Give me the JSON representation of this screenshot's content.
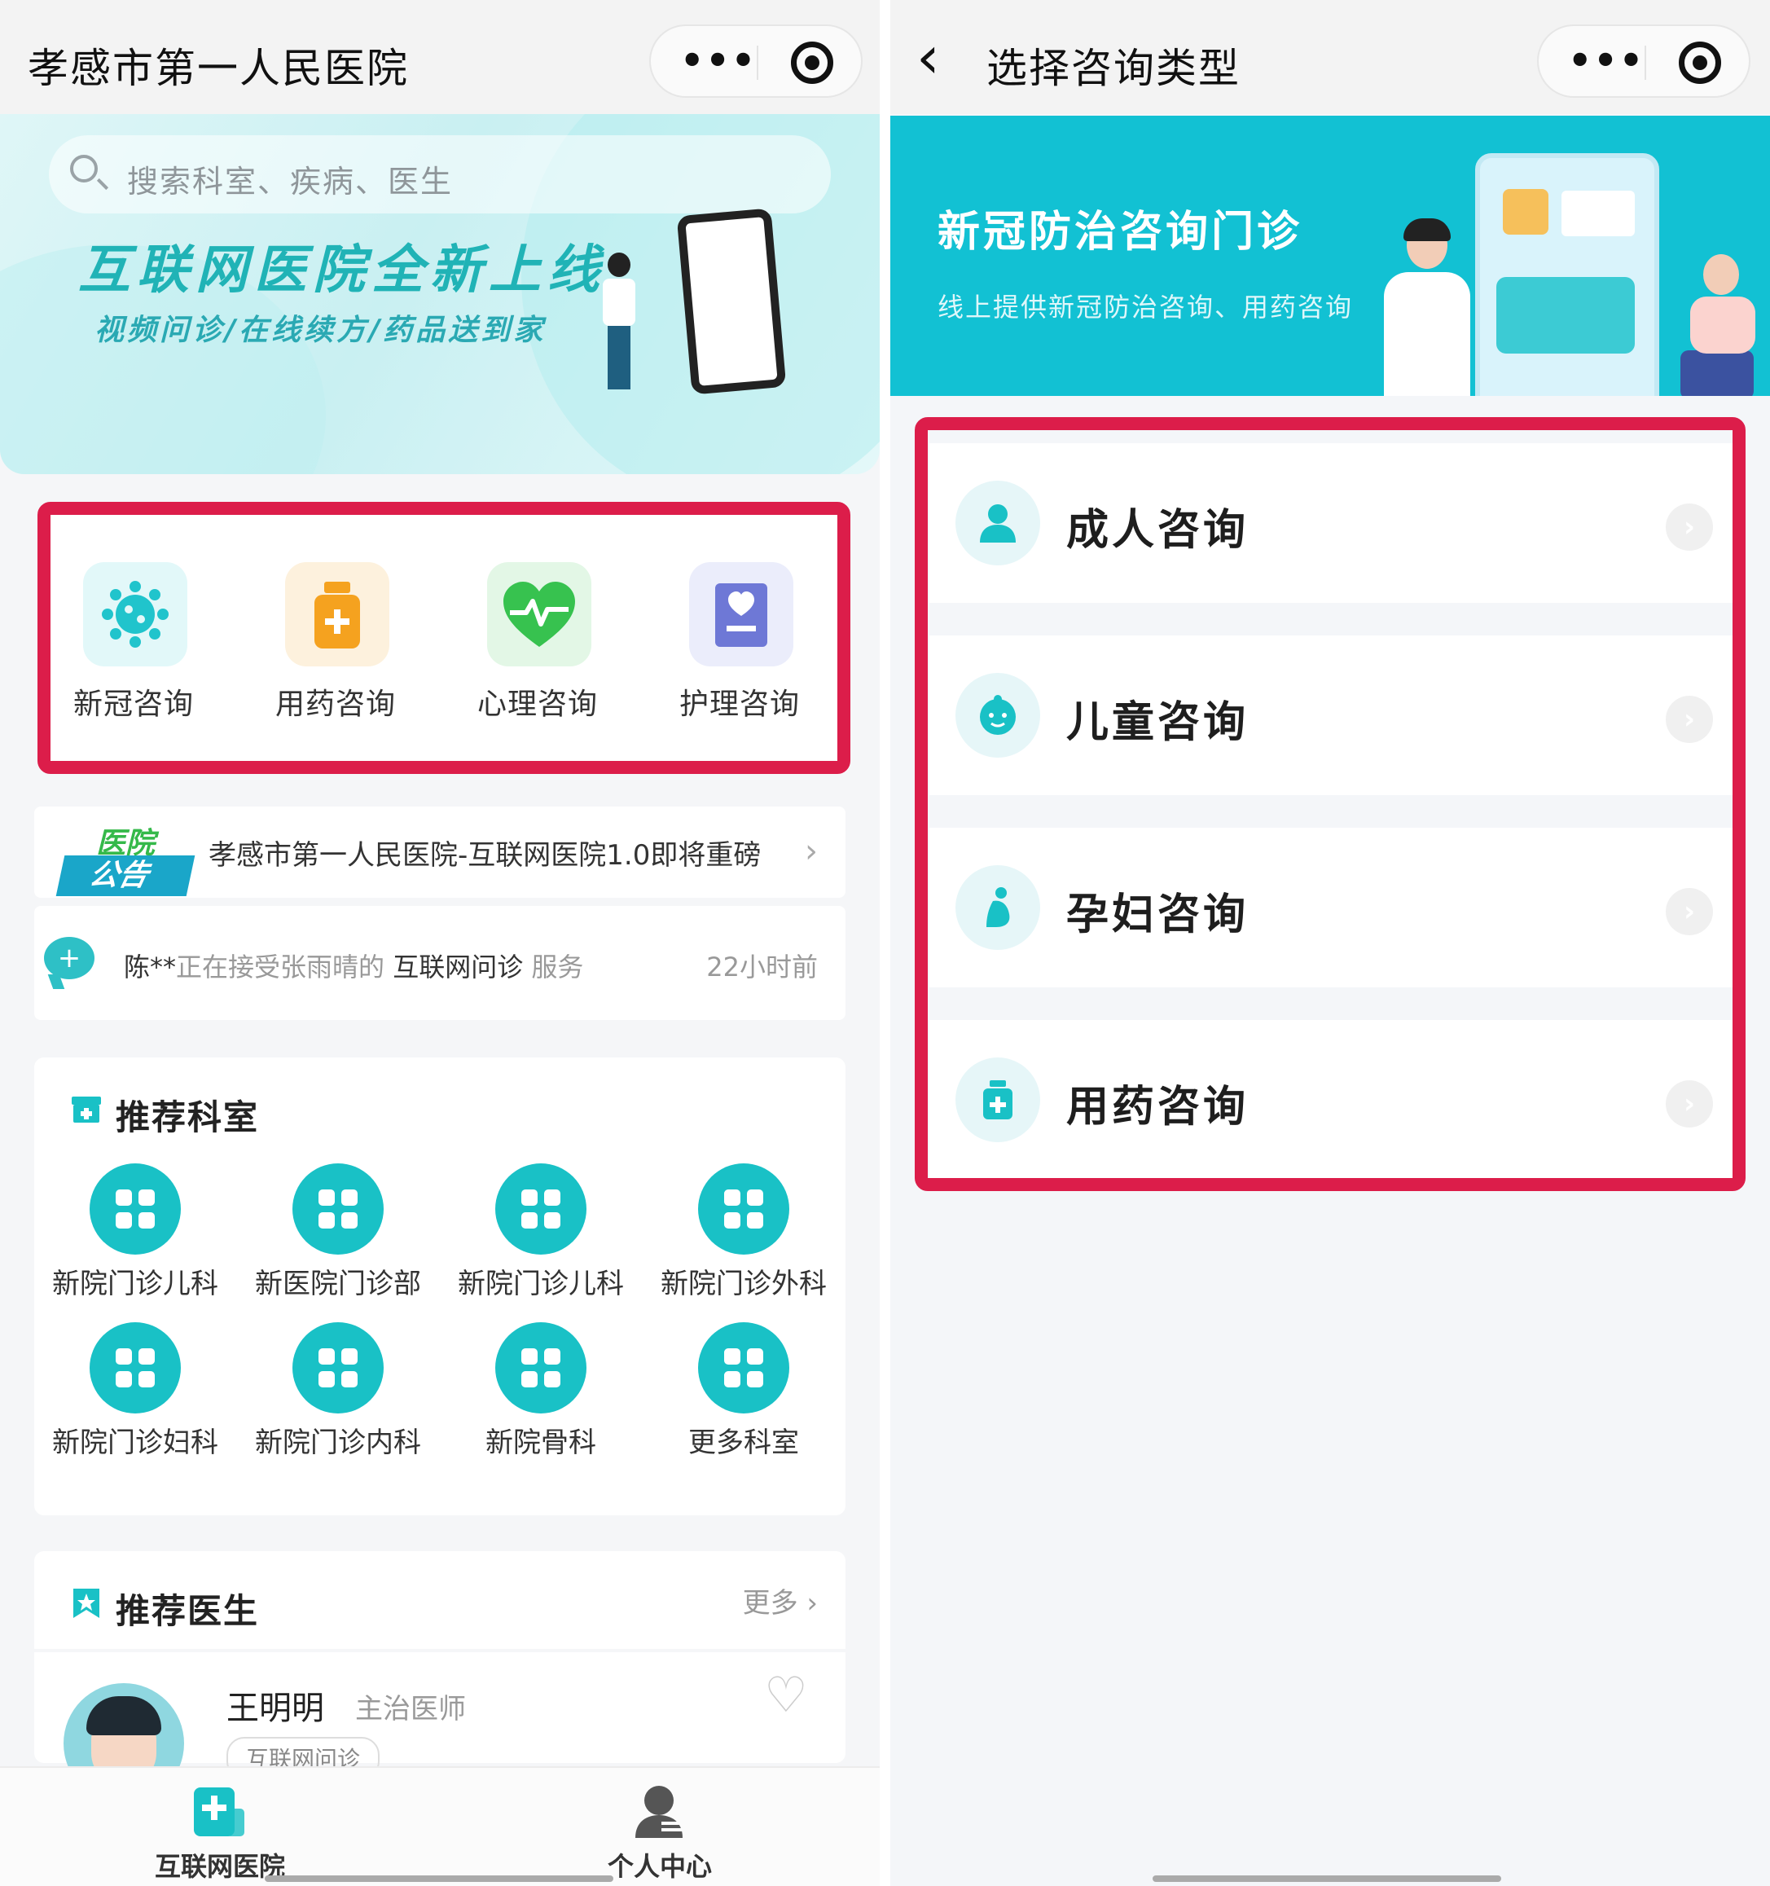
{
  "left": {
    "header": {
      "title": "孝感市第一人民医院"
    },
    "search": {
      "placeholder": "搜索科室、疾病、医生"
    },
    "banner": {
      "headline": "互联网医院全新上线",
      "subline": "视频问诊/在线续方/药品送到家"
    },
    "quick_services": [
      {
        "label": "新冠咨询",
        "icon": "virus-icon",
        "color": "#20c4cc"
      },
      {
        "label": "用药咨询",
        "icon": "medicine-bottle-icon",
        "color": "#f5a21f"
      },
      {
        "label": "心理咨询",
        "icon": "heart-pulse-icon",
        "color": "#37c24f"
      },
      {
        "label": "护理咨询",
        "icon": "nursing-badge-icon",
        "color": "#6e78d6"
      }
    ],
    "notice": {
      "tag_top": "医院",
      "tag_bottom": "公告",
      "text": "孝感市第一人民医院-互联网医院1.0即将重磅",
      "chevron": "›"
    },
    "feed": {
      "user": "陈**",
      "action": "正在接受张雨晴的",
      "service": "互联网问诊",
      "suffix": "服务",
      "time": "22小时前"
    },
    "departments": {
      "title": "推荐科室",
      "items": [
        "新院门诊儿科",
        "新医院门诊部",
        "新院门诊儿科",
        "新院门诊外科",
        "新院门诊妇科",
        "新院门诊内科",
        "新院骨科",
        "更多科室"
      ]
    },
    "doctors": {
      "title": "推荐医生",
      "more": "更多",
      "first": {
        "name": "王明明",
        "title": "主治医师",
        "tag": "互联网问诊"
      }
    },
    "tabbar": [
      {
        "label": "互联网医院",
        "icon": "hospital-plus-icon",
        "active": true,
        "color": "#19c1c6"
      },
      {
        "label": "个人中心",
        "icon": "person-icon",
        "active": false,
        "color": "#555555"
      }
    ]
  },
  "right": {
    "header": {
      "back": "‹",
      "title": "选择咨询类型"
    },
    "banner": {
      "title": "新冠防治咨询门诊",
      "subtitle": "线上提供新冠防治咨询、用药咨询"
    },
    "consult_types": [
      {
        "label": "成人咨询",
        "icon": "adult-icon"
      },
      {
        "label": "儿童咨询",
        "icon": "child-face-icon"
      },
      {
        "label": "孕妇咨询",
        "icon": "pregnant-icon"
      },
      {
        "label": "用药咨询",
        "icon": "medicine-bottle-icon"
      }
    ],
    "row_chevron": "›"
  },
  "colors": {
    "accent": "#19c1c6",
    "highlight_frame": "#dc1d4a",
    "banner_teal": "#12c1d3"
  }
}
